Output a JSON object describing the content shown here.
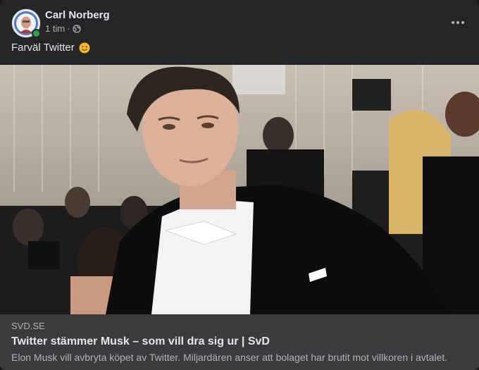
{
  "post": {
    "author": "Carl Norberg",
    "time": "1 tim",
    "separator": "·",
    "privacy_icon": "globe-icon",
    "more_icon": "more-icon",
    "text": "Farväl Twitter",
    "emoji": "wink-emoji"
  },
  "link": {
    "domain": "SVD.SE",
    "title": "Twitter stämmer Musk – som vill dra sig ur | SvD",
    "description": "Elon Musk vill avbryta köpet av Twitter. Miljardären anser att bolaget har brutit mot villkoren i avtalet."
  },
  "colors": {
    "card_bg": "#242526",
    "link_bg": "#3a3b3c",
    "primary_text": "#e4e6eb",
    "secondary_text": "#b0b3b8",
    "online": "#31a24c"
  }
}
